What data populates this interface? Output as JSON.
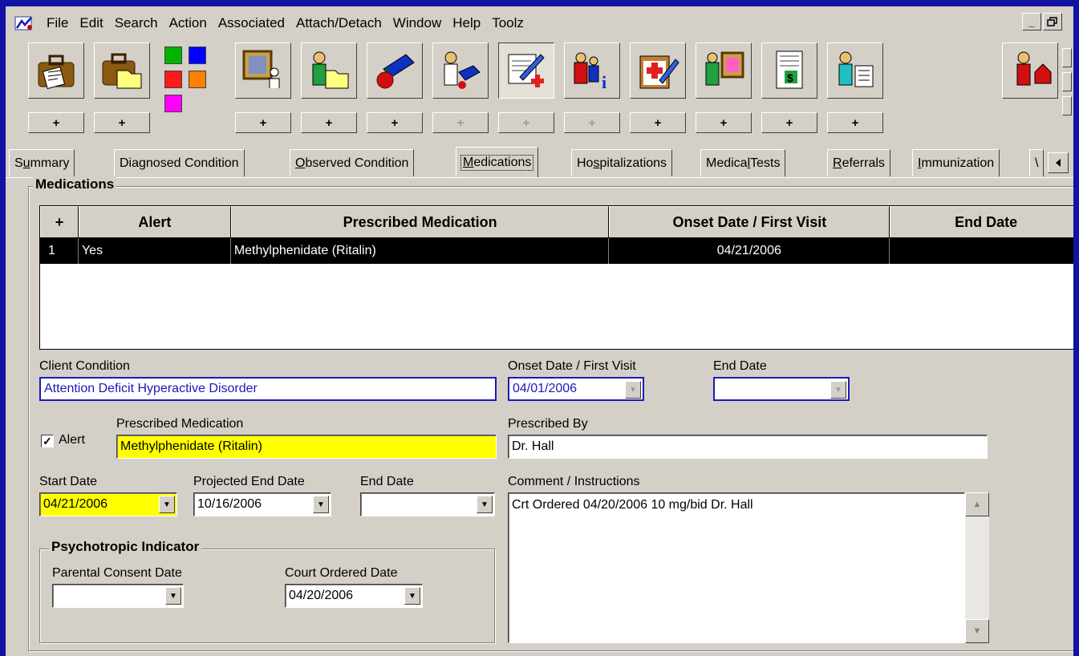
{
  "menu": {
    "items": [
      "File",
      "Edit",
      "Search",
      "Action",
      "Associated",
      "Attach/Detach",
      "Window",
      "Help",
      "Toolz"
    ],
    "window_restore": "🗗",
    "window_min": "_"
  },
  "toolbar": {
    "plus": "+",
    "swatches": [
      "#00b400",
      "#0000ff",
      "#ff1a1a",
      "#ff8000",
      "#ff00ff"
    ]
  },
  "tabs": [
    {
      "pre": "S",
      "u": "u",
      "post": "mmary"
    },
    {
      "pre": "",
      "u": "",
      "post": "Diagnosed Condition"
    },
    {
      "pre": "",
      "u": "O",
      "post": "bserved Condition"
    },
    {
      "pre": "",
      "u": "M",
      "post": "edications"
    },
    {
      "pre": "Ho",
      "u": "s",
      "post": "pitalizations"
    },
    {
      "pre": "Medica",
      "u": "l",
      "post": " Tests"
    },
    {
      "pre": "",
      "u": "R",
      "post": "eferrals"
    },
    {
      "pre": "",
      "u": "I",
      "post": "mmunization"
    },
    {
      "pre": "\\",
      "u": "",
      "post": ""
    }
  ],
  "medications_group": {
    "title": "Medications"
  },
  "grid": {
    "columns": [
      "+",
      "Alert",
      "Prescribed Medication",
      "Onset Date / First Visit",
      "End Date"
    ],
    "rows": [
      {
        "num": "1",
        "alert": "Yes",
        "medication": "Methylphenidate (Ritalin)",
        "onset": "04/21/2006",
        "end": ""
      }
    ]
  },
  "form": {
    "client_condition_label": "Client Condition",
    "client_condition": "Attention Deficit Hyperactive Disorder",
    "onset_label": "Onset Date / First Visit",
    "onset_value": "04/01/2006",
    "end_date_label": "End Date",
    "end_date_value": "",
    "alert_label": "Alert",
    "alert_checked": "✓",
    "prescribed_med_label": "Prescribed Medication",
    "prescribed_med_value": "Methylphenidate (Ritalin)",
    "prescribed_by_label": "Prescribed By",
    "prescribed_by_value": "Dr. Hall",
    "start_date_label": "Start Date",
    "start_date_value": "04/21/2006",
    "projected_end_label": "Projected End Date",
    "projected_end_value": "10/16/2006",
    "end_date2_label": "End Date",
    "end_date2_value": "",
    "comment_label": "Comment / Instructions",
    "comment_value": "Crt Ordered 04/20/2006 10 mg/bid Dr. Hall",
    "psych_title": "Psychotropic Indicator",
    "parental_label": "Parental Consent Date",
    "parental_value": "",
    "court_label": "Court Ordered Date",
    "court_value": "04/20/2006",
    "dropdown_glyph": "▼",
    "scroll_up": "▲",
    "scroll_down": "▼"
  }
}
